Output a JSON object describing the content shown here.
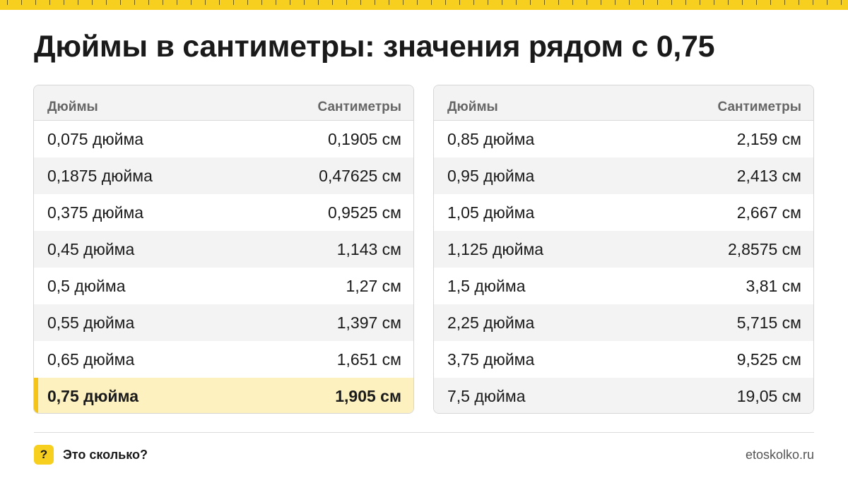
{
  "title": "Дюймы в сантиметры: значения рядом с 0,75",
  "colors": {
    "accent": "#f7cf1e",
    "highlight_bg": "#fdf1c0",
    "stripe": "#f3f3f3"
  },
  "tables": [
    {
      "headers": {
        "inches": "Дюймы",
        "cm": "Сантиметры"
      },
      "rows": [
        {
          "inches": "0,075 дюйма",
          "cm": "0,1905 см"
        },
        {
          "inches": "0,1875 дюйма",
          "cm": "0,47625 см"
        },
        {
          "inches": "0,375 дюйма",
          "cm": "0,9525 см"
        },
        {
          "inches": "0,45 дюйма",
          "cm": "1,143 см"
        },
        {
          "inches": "0,5 дюйма",
          "cm": "1,27 см"
        },
        {
          "inches": "0,55 дюйма",
          "cm": "1,397 см"
        },
        {
          "inches": "0,65 дюйма",
          "cm": "1,651 см"
        },
        {
          "inches": "0,75 дюйма",
          "cm": "1,905 см"
        }
      ]
    },
    {
      "headers": {
        "inches": "Дюймы",
        "cm": "Сантиметры"
      },
      "rows": [
        {
          "inches": "0,85 дюйма",
          "cm": "2,159 см"
        },
        {
          "inches": "0,95 дюйма",
          "cm": "2,413 см"
        },
        {
          "inches": "1,05 дюйма",
          "cm": "2,667 см"
        },
        {
          "inches": "1,125 дюйма",
          "cm": "2,8575 см"
        },
        {
          "inches": "1,5 дюйма",
          "cm": "3,81 см"
        },
        {
          "inches": "2,25 дюйма",
          "cm": "5,715 см"
        },
        {
          "inches": "3,75 дюйма",
          "cm": "9,525 см"
        },
        {
          "inches": "7,5 дюйма",
          "cm": "19,05 см"
        }
      ]
    }
  ],
  "footer": {
    "logo_mark": "?",
    "brand": "Это сколько?",
    "site": "etoskolko.ru"
  }
}
